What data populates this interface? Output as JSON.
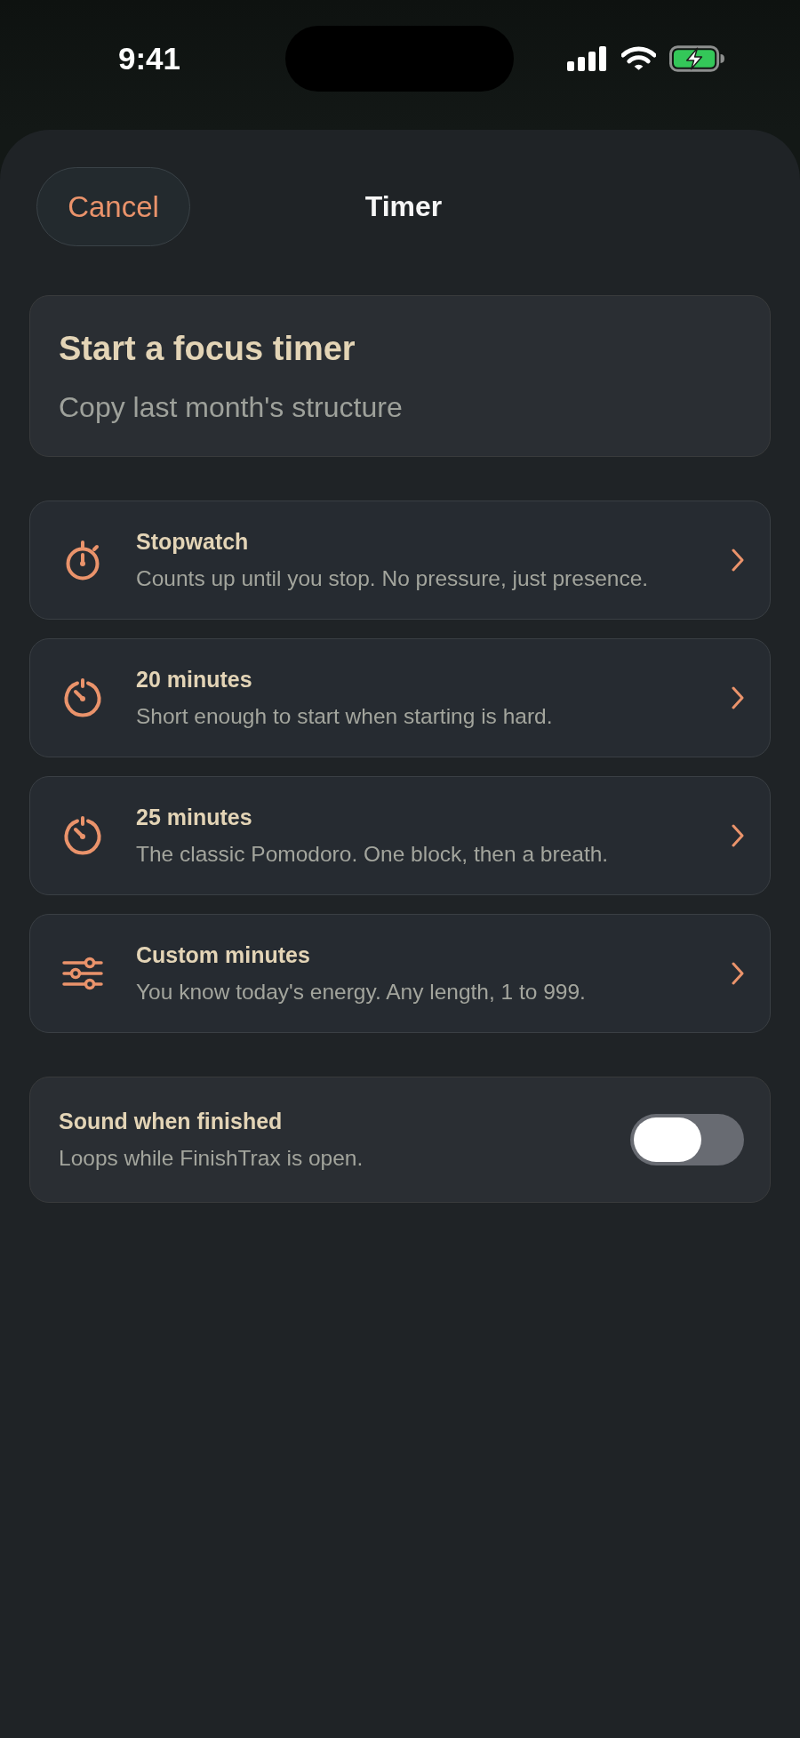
{
  "status_bar": {
    "time": "9:41"
  },
  "header": {
    "cancel": "Cancel",
    "title": "Timer"
  },
  "intro_card": {
    "title": "Start a focus timer",
    "subtitle": "Copy last month's structure"
  },
  "options": [
    {
      "kind": "stopwatch",
      "title": "Stopwatch",
      "description": "Counts up until you stop. No pressure, just presence."
    },
    {
      "kind": "timer",
      "title": "20 minutes",
      "description": "Short enough to start when starting is hard."
    },
    {
      "kind": "timer",
      "title": "25 minutes",
      "description": "The classic Pomodoro. One block, then a breath."
    },
    {
      "kind": "custom",
      "title": "Custom minutes",
      "description": "You know today's energy. Any length, 1 to 999."
    }
  ],
  "sound_setting": {
    "title": "Sound when finished",
    "description": "Loops while FinishTrax is open.",
    "on": false
  }
}
